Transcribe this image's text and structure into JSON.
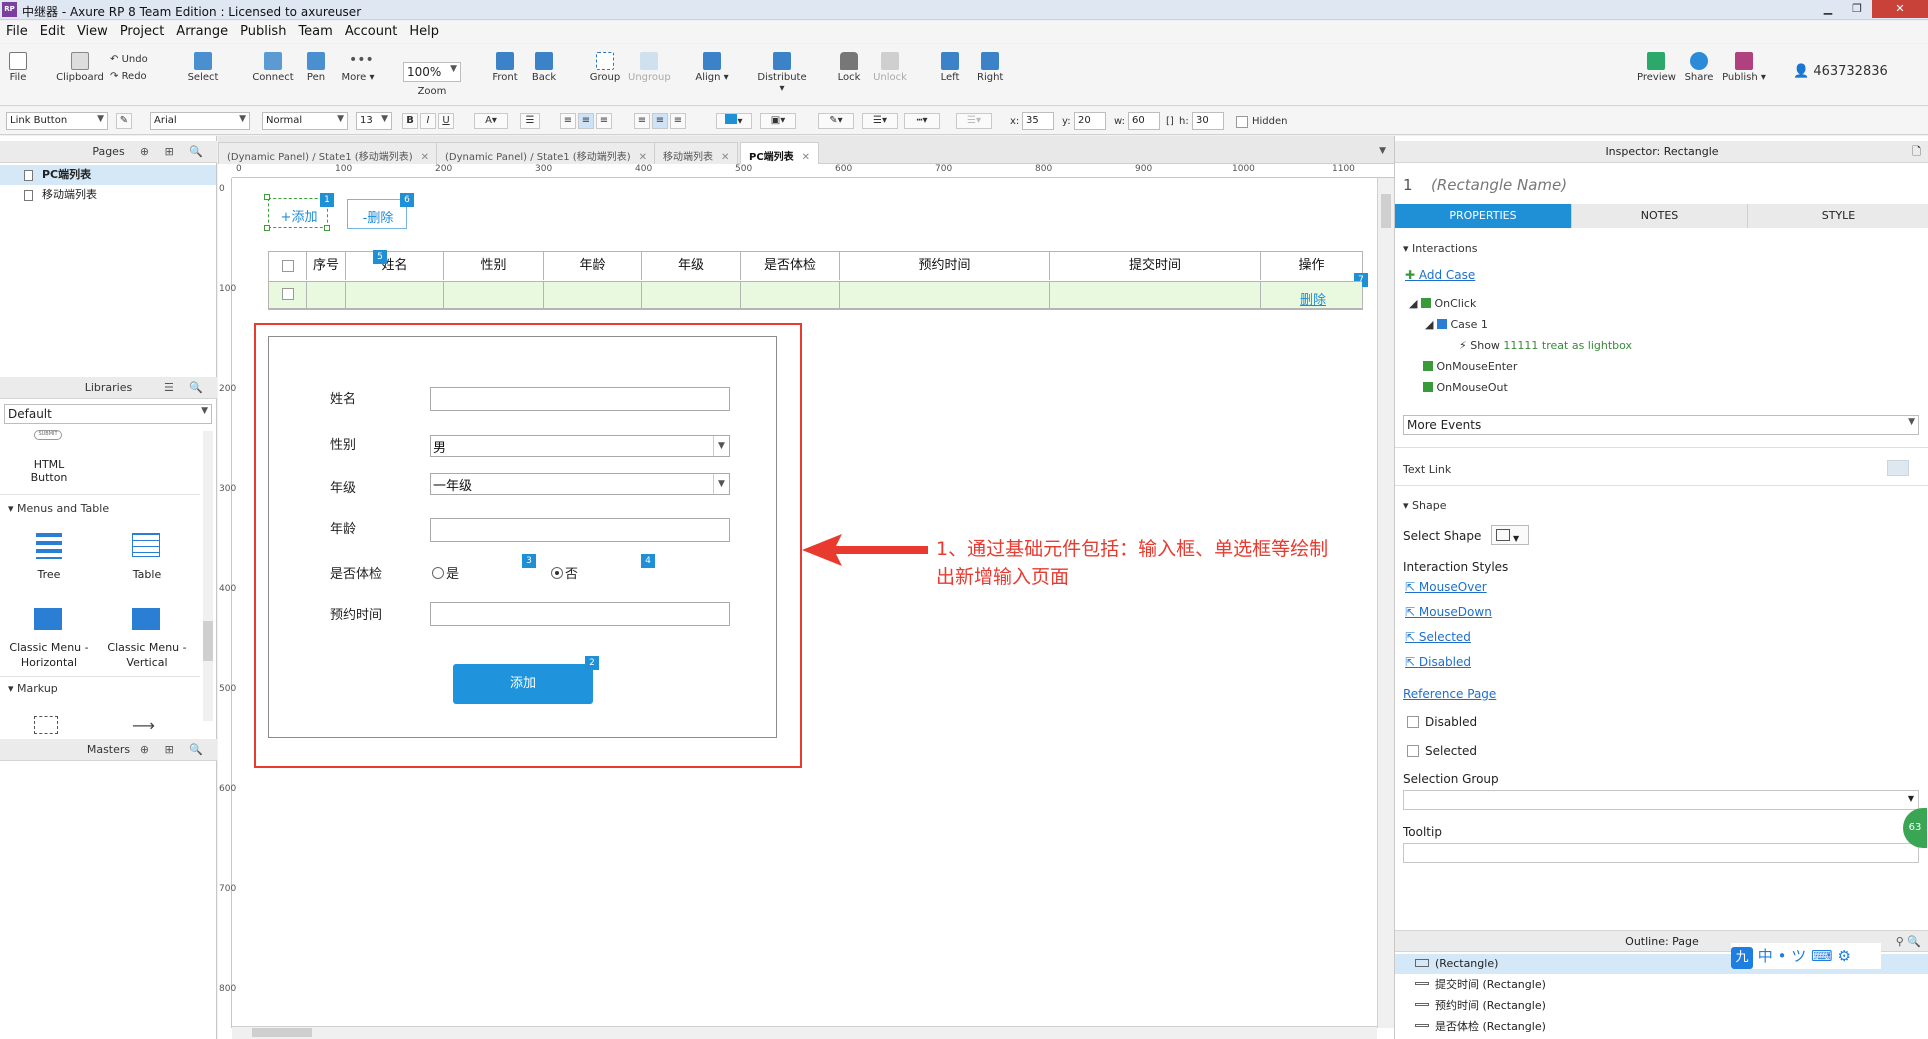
{
  "window": {
    "title": "中继器 - Axure RP 8 Team Edition : Licensed to axureuser",
    "app_icon": "RP"
  },
  "menu": [
    "File",
    "Edit",
    "View",
    "Project",
    "Arrange",
    "Publish",
    "Team",
    "Account",
    "Help"
  ],
  "toolbar": {
    "file": "File",
    "clipboard": "Clipboard",
    "undo": "Undo",
    "redo": "Redo",
    "select": "Select",
    "connect": "Connect",
    "pen": "Pen",
    "more": "More ▾",
    "zoom_value": "100%",
    "zoom": "Zoom",
    "front": "Front",
    "back": "Back",
    "group": "Group",
    "ungroup": "Ungroup",
    "align": "Align ▾",
    "distribute": "Distribute ▾",
    "lock": "Lock",
    "unlock": "Unlock",
    "left": "Left",
    "right": "Right",
    "preview": "Preview",
    "share": "Share",
    "publish": "Publish ▾",
    "user": "463732836"
  },
  "format": {
    "widget_style": "Link Button",
    "font": "Arial",
    "weight": "Normal",
    "size": "13",
    "x_label": "x:",
    "x": "35",
    "y_label": "y:",
    "y": "20",
    "w_label": "w:",
    "w": "60",
    "h_label": "h:",
    "h": "30",
    "hidden": "Hidden"
  },
  "pages": {
    "header": "Pages",
    "items": [
      "PC端列表",
      "移动端列表"
    ]
  },
  "libraries": {
    "header": "Libraries",
    "selected": "Default",
    "html_button": "HTML Button",
    "group_menus": "Menus and Table",
    "tree": "Tree",
    "table": "Table",
    "classic_h": "Classic Menu - Horizontal",
    "classic_v": "Classic Menu - Vertical",
    "group_markup": "Markup"
  },
  "masters": {
    "header": "Masters"
  },
  "tabs": [
    "(Dynamic Panel) / State1 (移动端列表)",
    "(Dynamic Panel) / State1 (移动端列表)",
    "移动端列表",
    "PC端列表"
  ],
  "ruler_h": [
    "0",
    "100",
    "200",
    "300",
    "400",
    "500",
    "600",
    "700",
    "800",
    "900",
    "1000",
    "1100"
  ],
  "ruler_v": [
    "0",
    "100",
    "200",
    "300",
    "400",
    "500",
    "600",
    "700",
    "800"
  ],
  "canvas": {
    "add_button": "+添加",
    "delete_button": "-删除",
    "badges": [
      "1",
      "6",
      "5",
      "7",
      "3",
      "4",
      "2"
    ],
    "columns": [
      "序号",
      "姓名",
      "性别",
      "年龄",
      "年级",
      "是否体检",
      "预约时间",
      "提交时间",
      "操作"
    ],
    "row_action": "删除",
    "form": {
      "name_label": "姓名",
      "gender_label": "性别",
      "gender_value": "男",
      "grade_label": "年级",
      "grade_value": "一年级",
      "age_label": "年龄",
      "checkup_label": "是否体检",
      "yes": "是",
      "no": "否",
      "appt_label": "预约时间",
      "submit": "添加"
    },
    "annotation": "1、通过基础元件包括：输入框、单选框等绘制出新增输入页面"
  },
  "inspector": {
    "header": "Inspector: Rectangle",
    "index": "1",
    "name_placeholder": "(Rectangle Name)",
    "tabs": [
      "PROPERTIES",
      "NOTES",
      "STYLE"
    ],
    "interactions": "Interactions",
    "add_case": "Add Case",
    "onclick": "OnClick",
    "case1": "Case 1",
    "show_action": "Show",
    "show_target": "11111 treat as lightbox",
    "onmouseenter": "OnMouseEnter",
    "onmouseout": "OnMouseOut",
    "more_events": "More Events",
    "text_link": "Text Link",
    "shape": "Shape",
    "select_shape": "Select Shape",
    "interaction_styles": "Interaction Styles",
    "mouseover": "MouseOver",
    "mousedown": "MouseDown",
    "selected_style": "Selected",
    "disabled_style": "Disabled",
    "reference_page": "Reference Page",
    "disabled": "Disabled",
    "selected": "Selected",
    "selection_group": "Selection Group",
    "tooltip": "Tooltip"
  },
  "outline": {
    "header": "Outline: Page",
    "items": [
      "(Rectangle)",
      "提交时间 (Rectangle)",
      "预约时间 (Rectangle)",
      "是否体检 (Rectangle)"
    ]
  },
  "ime": [
    "九",
    "中",
    "•",
    "ツ",
    "⌨",
    "⚙"
  ],
  "side_badge": "63",
  "colors": {
    "accent": "#1f8fd6",
    "annotation_red": "#e83a2f",
    "row_green": "#e9f9e0"
  }
}
